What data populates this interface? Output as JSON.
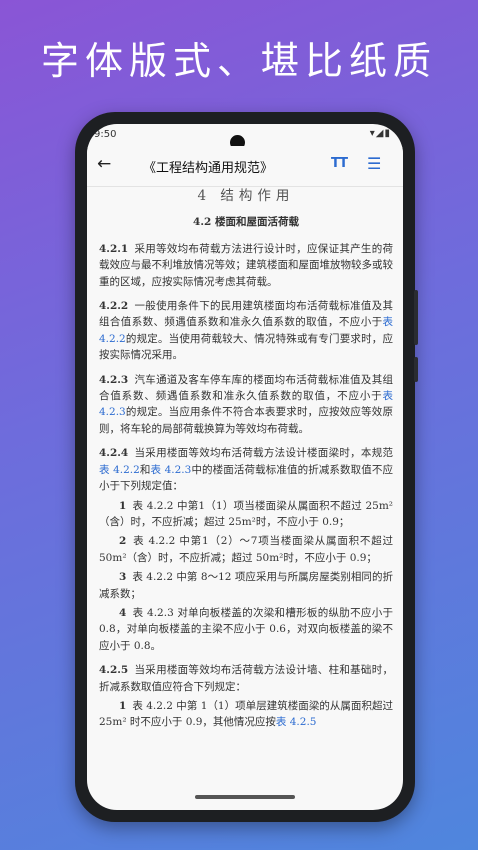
{
  "headline": "字体版式、堪比纸质",
  "status": {
    "time": "9:50",
    "icons": "▾◢▮"
  },
  "appbar": {
    "title": "《工程结构通用规范》",
    "back_icon": "arrow-left-icon",
    "font_icon": "text-size-icon",
    "font_glyph": "TT",
    "toc_icon": "list-icon",
    "toc_glyph": "☰"
  },
  "doc": {
    "chapter": "4 结构作用",
    "section": "4.2 楼面和屋面活荷载",
    "p1": {
      "num": "4.2.1",
      "text": "采用等效均布荷载方法进行设计时，应保证其产生的荷载效应与最不利堆放情况等效；建筑楼面和屋面堆放物较多或较重的区域，应按实际情况考虑其荷载。"
    },
    "p2": {
      "num": "4.2.2",
      "a": "一般使用条件下的民用建筑楼面均布活荷载标准值及其组合值系数、频遇值系数和准永久值系数的取值，不应小于",
      "link": "表 4.2.2",
      "b": "的规定。当使用荷载较大、情况特殊或有专门要求时，应按实际情况采用。"
    },
    "p3": {
      "num": "4.2.3",
      "a": "汽车通道及客车停车库的楼面均布活荷载标准值及其组合值系数、频遇值系数和准永久值系数的取值，不应小于",
      "link": "表 4.2.3",
      "b": "的规定。当应用条件不符合本表要求时，应按效应等效原则，将车轮的局部荷载换算为等效均布荷载。"
    },
    "p4": {
      "num": "4.2.4",
      "a": "当采用楼面等效均布活荷载方法设计楼面梁时，本规范",
      "link1": "表 4.2.2",
      "mid": "和",
      "link2": "表 4.2.3",
      "b": "中的楼面活荷载标准值的折减系数取值不应小于下列规定值："
    },
    "items": [
      {
        "n": "1",
        "text": "表 4.2.2 中第1（1）项当楼面梁从属面积不超过 25m²（含）时，不应折减；超过 25m²时，不应小于 0.9；"
      },
      {
        "n": "2",
        "text": "表 4.2.2 中第1（2）～7项当楼面梁从属面积不超过 50m²（含）时，不应折减；超过 50m²时，不应小于 0.9；"
      },
      {
        "n": "3",
        "text": "表 4.2.2 中第 8～12 项应采用与所属房屋类别相同的折减系数；"
      },
      {
        "n": "4",
        "text": "表 4.2.3 对单向板楼盖的次梁和槽形板的纵肋不应小于 0.8，对单向板楼盖的主梁不应小于 0.6，对双向板楼盖的梁不应小于 0.8。"
      }
    ],
    "p5": {
      "num": "4.2.5",
      "text": "当采用楼面等效均布活荷载方法设计墙、柱和基础时，折减系数取值应符合下列规定："
    },
    "item5": {
      "n": "1",
      "a": "表 4.2.2 中第 1（1）项单层建筑楼面梁的从属面积超过 25m² 时不应小于 0.9，其他情况应按",
      "link": "表 4.2.5"
    }
  }
}
